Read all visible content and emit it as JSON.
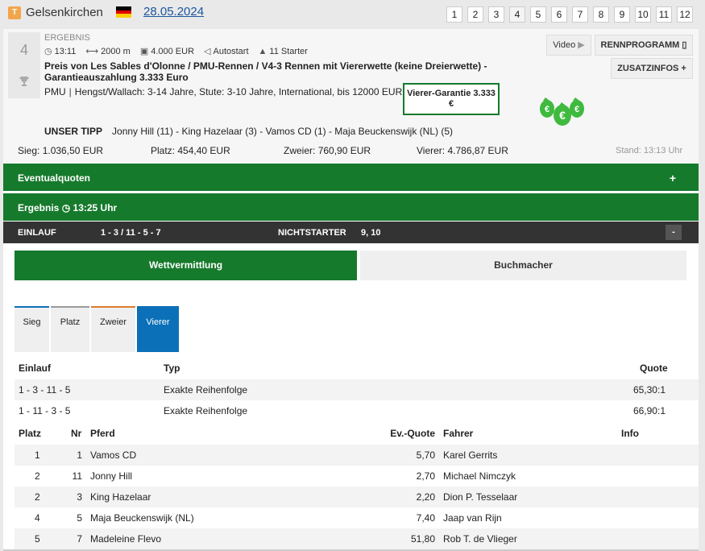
{
  "header": {
    "badge": "T",
    "track": "Gelsenkirchen",
    "date": "28.05.2024",
    "races": [
      "1",
      "2",
      "3",
      "4",
      "5",
      "6",
      "7",
      "8",
      "9",
      "10",
      "11",
      "12"
    ],
    "active_race": "4"
  },
  "race": {
    "number": "4",
    "status": "ERGEBNIS",
    "time": "13:11",
    "distance": "2000 m",
    "purse": "4.000 EUR",
    "start": "Autostart",
    "starters": "11 Starter",
    "title": "Preis von Les Sables d'Olonne / PMU-Rennen / V4-3 Rennen mit Viererwette (keine Dreierwette) - Garantieauszahlung 3.333 Euro",
    "pmu": "PMU",
    "conditions": "Hengst/Wallach: 3-14 Jahre, Stute: 3-10 Jahre, International, bis 12000 EUR",
    "guarantee": "Vierer-Garantie 3.333 €",
    "video_label": "Video",
    "program_label": "RENNPROGRAMM",
    "extra_label": "ZUSATZINFOS",
    "tipp_label": "UNSER TIPP",
    "tipp": "Jonny Hill (11) - King Hazelaar (3) - Vamos CD (1) - Maja Beuckenswijk (NL) (5)"
  },
  "pools": {
    "sieg": {
      "label": "Sieg:",
      "value": "1.036,50 EUR"
    },
    "platz": {
      "label": "Platz:",
      "value": "454,40 EUR"
    },
    "zweier": {
      "label": "Zweier:",
      "value": "760,90 EUR"
    },
    "vierer": {
      "label": "Vierer:",
      "value": "4.786,87 EUR"
    },
    "stand": "Stand: 13:13 Uhr"
  },
  "sections": {
    "eventual": "Eventualquoten",
    "eventual_toggle": "+",
    "result": "Ergebnis",
    "result_time": "13:25 Uhr",
    "einlauf_label": "EINLAUF",
    "einlauf": "1 - 3 / 11 - 5 - 7",
    "ns_label": "NICHTSTARTER",
    "ns": "9, 10",
    "collapse": "-"
  },
  "tabs": {
    "wett": "Wettvermittlung",
    "buch": "Buchmacher",
    "sub": [
      "Sieg",
      "Platz",
      "Zweier",
      "Vierer"
    ],
    "active_sub": "Vierer"
  },
  "quotes": {
    "headers": {
      "einlauf": "Einlauf",
      "typ": "Typ",
      "quote": "Quote"
    },
    "rows": [
      {
        "einlauf": "1 - 3 - 11 - 5",
        "typ": "Exakte Reihenfolge",
        "quote": "65,30:1"
      },
      {
        "einlauf": "1 - 11 - 3 - 5",
        "typ": "Exakte Reihenfolge",
        "quote": "66,90:1"
      }
    ]
  },
  "results": {
    "headers": {
      "platz": "Platz",
      "nr": "Nr",
      "pferd": "Pferd",
      "ev": "Ev.-Quote",
      "fahrer": "Fahrer",
      "info": "Info"
    },
    "rows": [
      {
        "platz": "1",
        "nr": "1",
        "pferd": "Vamos CD",
        "ev": "5,70",
        "fahrer": "Karel Gerrits"
      },
      {
        "platz": "2",
        "nr": "11",
        "pferd": "Jonny Hill",
        "ev": "2,70",
        "fahrer": "Michael Nimczyk"
      },
      {
        "platz": "2",
        "nr": "3",
        "pferd": "King Hazelaar",
        "ev": "2,20",
        "fahrer": "Dion P. Tesselaar"
      },
      {
        "platz": "4",
        "nr": "5",
        "pferd": "Maja Beuckenswijk (NL)",
        "ev": "7,40",
        "fahrer": "Jaap van Rijn"
      },
      {
        "platz": "5",
        "nr": "7",
        "pferd": "Madeleine Flevo",
        "ev": "51,80",
        "fahrer": "Rob T. de Vlieger"
      }
    ]
  }
}
